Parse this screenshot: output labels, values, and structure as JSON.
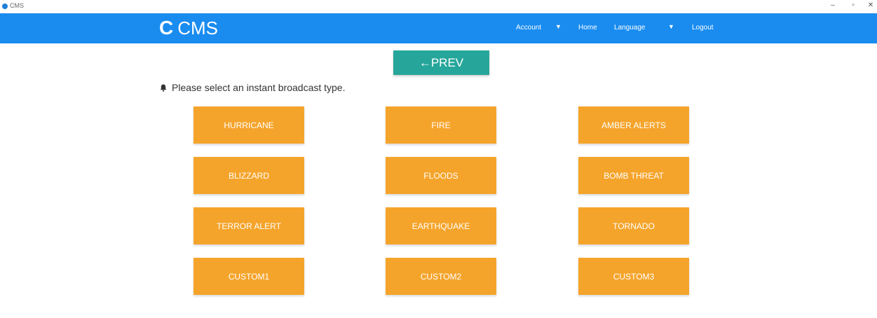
{
  "window": {
    "title": "CMS",
    "minimize_glyph": "–",
    "maximize_glyph": "▫",
    "close_glyph": "✕"
  },
  "header": {
    "brand_letter": "C",
    "brand_text": "CMS",
    "nav": {
      "account": "Account",
      "home": "Home",
      "language": "Language",
      "logout": "Logout"
    },
    "caret_glyph": "▼",
    "background_color": "#1a8cf0"
  },
  "prev_button": {
    "label": "←PREV",
    "color": "#26a69a"
  },
  "prompt": {
    "icon": "bell-icon",
    "text": "Please select an instant broadcast type."
  },
  "broadcast_types": {
    "color": "#f5a42b",
    "items": [
      "HURRICANE",
      "FIRE",
      "AMBER ALERTS",
      "BLIZZARD",
      "FLOODS",
      "BOMB THREAT",
      "TERROR ALERT",
      "EARTHQUAKE",
      "TORNADO",
      "CUSTOM1",
      "CUSTOM2",
      "CUSTOM3"
    ]
  }
}
